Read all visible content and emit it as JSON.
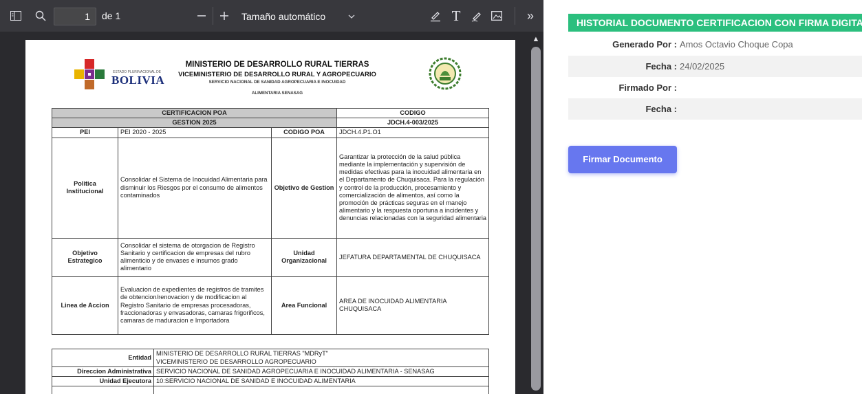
{
  "viewer": {
    "page_number": "1",
    "page_of": "de 1",
    "zoom_label": "Tamaño automático",
    "icons": [
      "sidebar-toggle-icon",
      "search-icon",
      "zoom-out-icon",
      "zoom-in-icon",
      "chevron-down-icon",
      "highlight-icon",
      "text-icon",
      "draw-icon",
      "image-icon",
      "more-tools-icon",
      "scroll-up-icon"
    ]
  },
  "document": {
    "logo_small": "ESTADO PLURINACIONAL DE",
    "logo_text": "BOLIVIA",
    "ministry": "MINISTERIO DE DESARROLLO RURAL TIERRAS",
    "vice_ministry": "VICEMINISTERIO DE DESARROLLO RURAL Y AGROPECUARIO",
    "service_line1": "SERVICIO NACIONAL DE SANIDAD AGROPECUARIA E INOCUIDAD",
    "service_line2": "ALIMENTARIA SENASAG",
    "cert_title": "CERTIFICACION POA",
    "gestion": "GESTION 2025",
    "codigo_label": "CODIGO",
    "codigo_value": "JDCH.4-003/2025",
    "pei_label": "PEI",
    "pei_value": "PEI 2020 - 2025",
    "codigo_poa_label": "CODIGO POA",
    "codigo_poa_value": "JDCH.4.P1.O1",
    "politica_label": "Politica Institucional",
    "politica_value": "Consolidar el Sistema de Inocuidad Alimentaria para disminuir los Riesgos por el consumo de alimentos contaminados",
    "objetivo_gestion_label": "Objetivo de Gestion",
    "objetivo_gestion_value": "Garantizar la protección de la salud pública mediante la implementación y supervisión de medidas efectivas para la inocuidad alimentaria en el Departamento de Chuquisaca. Para la regulación y control de la producción, procesamiento y comercialización de alimentos, así como la promoción de prácticas seguras en el manejo alimentario y la respuesta oportuna a incidentes y denuncias relacionadas con la seguridad alimentaria",
    "objetivo_estrategico_label": "Objetivo Estrategico",
    "objetivo_estrategico_value": "Consolidar el sistema de otorgacion de Registro Sanitario y certificacion de empresas del rubro alimenticio y de envases e insumos grado alimentario",
    "unidad_org_label": "Unidad Organizacional",
    "unidad_org_value": "JEFATURA DEPARTAMENTAL DE CHUQUISACA",
    "linea_label": "Linea de Accion",
    "linea_value": "Evaluacion de expedientes de registros de tramites de obtencion/renovacion y de modificacion al Registro Sanitario de empresas procesadoras, fraccionadoras y envasadoras, camaras frigorificos, camaras de maduracion e Importadora",
    "area_label": "Area Funcional",
    "area_value": "AREA DE INOCUIDAD ALIMENTARIA CHUQUISACA",
    "entidad_label": "Entidad",
    "entidad_value_1": "MINISTERIO DE DESARROLLO RURAL TIERRAS \"MDRyT\"",
    "entidad_value_2": "VICEMINISTERIO DE DESARROLLO AGROPECUARIO",
    "direccion_label": "Direccion Administrativa",
    "direccion_value": "SERVICIO NACIONAL DE SANIDAD AGROPECUARIA E INOCUIDAD ALIMENTARIA - SENASAG",
    "unidad_ej_label": "Unidad Ejecutora",
    "unidad_ej_value": "10:SERVICIO NACIONAL DE SANIDAD E INOCUIDAD ALIMENTARIA"
  },
  "history": {
    "title": "HISTORIAL DOCUMENTO CERTIFICACION CON FIRMA DIGITAL",
    "generado_label": "Generado Por :",
    "generado_value": "Amos Octavio Choque Copa",
    "fecha1_label": "Fecha :",
    "fecha1_value": "24/02/2025",
    "firmado_label": "Firmado Por :",
    "firmado_value": "",
    "fecha2_label": "Fecha :",
    "fecha2_value": "",
    "sign_button": "Firmar Documento"
  },
  "colors": {
    "history_header": "#2bbf7e",
    "sign_button": "#6777ef",
    "toolbar": "#38383d",
    "viewer_bg": "#2a2a2e"
  }
}
